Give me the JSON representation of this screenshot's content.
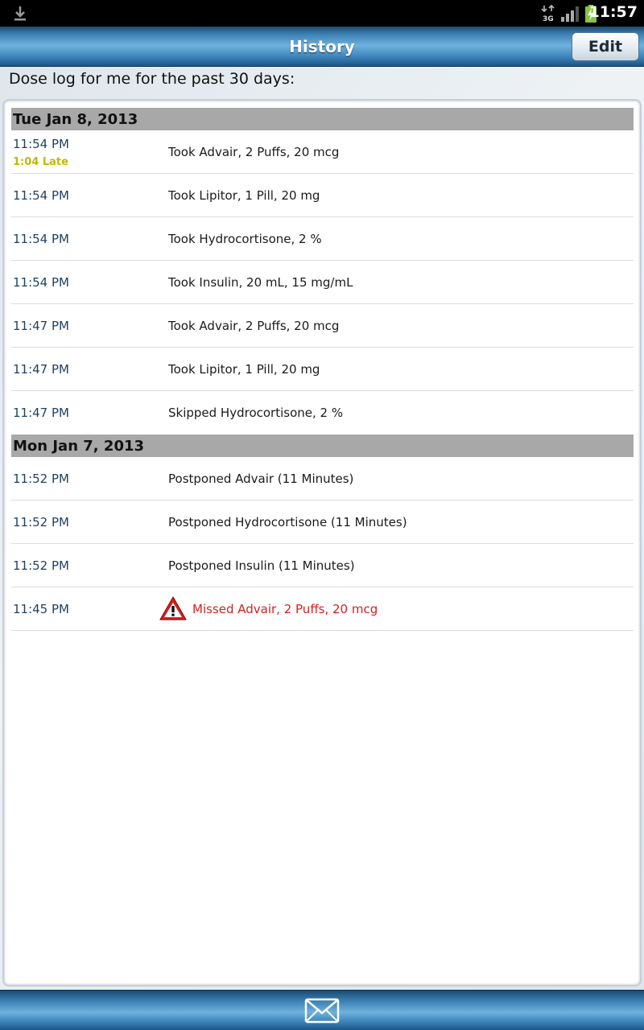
{
  "status_bar": {
    "time": "11:57",
    "network": "3G",
    "icons": [
      "download-icon",
      "network-3g-icon",
      "signal-icon",
      "battery-charging-icon"
    ]
  },
  "header": {
    "title": "History",
    "edit_label": "Edit"
  },
  "subtitle": "Dose log for me for the past 30 days:",
  "sections": [
    {
      "date": "Tue Jan 8, 2013",
      "entries": [
        {
          "time": "11:54 PM",
          "late": "1:04 Late",
          "text": "Took Advair, 2 Puffs, 20 mcg"
        },
        {
          "time": "11:54 PM",
          "text": "Took Lipitor, 1 Pill, 20 mg"
        },
        {
          "time": "11:54 PM",
          "text": "Took Hydrocortisone, 2 %"
        },
        {
          "time": "11:54 PM",
          "text": "Took Insulin, 20 mL, 15 mg/mL"
        },
        {
          "time": "11:47 PM",
          "text": "Took Advair, 2 Puffs, 20 mcg"
        },
        {
          "time": "11:47 PM",
          "text": "Took Lipitor, 1 Pill, 20 mg"
        },
        {
          "time": "11:47 PM",
          "text": "Skipped Hydrocortisone, 2 %"
        }
      ]
    },
    {
      "date": "Mon Jan 7, 2013",
      "entries": [
        {
          "time": "11:52 PM",
          "text": "Postponed Advair (11 Minutes)"
        },
        {
          "time": "11:52 PM",
          "text": "Postponed Hydrocortisone (11 Minutes)"
        },
        {
          "time": "11:52 PM",
          "text": "Postponed Insulin (11 Minutes)"
        },
        {
          "time": "11:45 PM",
          "text": "Missed Advair, 2 Puffs, 20 mcg",
          "missed": true
        }
      ]
    }
  ],
  "colors": {
    "time_text": "#1f3f5f",
    "late_text": "#c4b800",
    "missed_text": "#d42020",
    "section_header_bg": "#a8a8a8"
  },
  "bottom_bar": {
    "icons": [
      "mail-icon"
    ]
  }
}
